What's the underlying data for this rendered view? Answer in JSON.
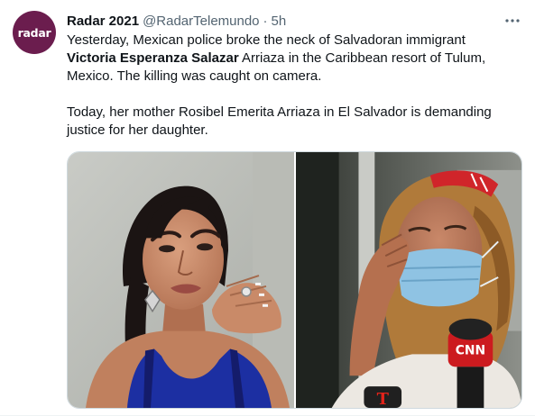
{
  "tweet": {
    "avatar_text": "radar",
    "author_name": "Radar 2021",
    "author_handle": "@RadarTelemundo",
    "separator": "·",
    "time": "5h",
    "paragraph1": {
      "before": "Yesterday, Mexican police broke the neck of Salvadoran immigrant ",
      "bold": "Victoria Esperanza Salazar",
      "after": " Arriaza in the Caribbean resort of Tulum, Mexico. The killing was caught on camera."
    },
    "paragraph2": "Today, her mother Rosibel Emerita Arriaza in El Salvador is demanding justice for her daughter.",
    "media": {
      "microphone_logos": [
        "CNN",
        "T"
      ]
    }
  },
  "colors": {
    "text_primary": "#0f1419",
    "text_secondary": "#536471",
    "avatar_bg": "#6b1d4e",
    "border": "#cfd9de"
  },
  "icons": {
    "more": "more-icon"
  }
}
